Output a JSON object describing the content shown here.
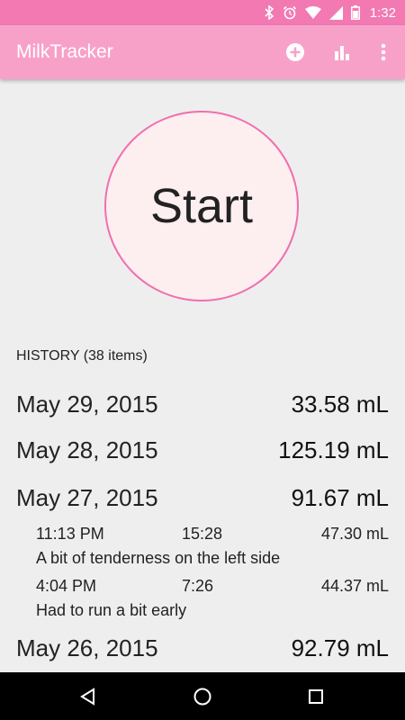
{
  "status_bar": {
    "time": "1:32"
  },
  "app_bar": {
    "title": "MilkTracker",
    "actions": [
      {
        "icon": "add-circle-icon"
      },
      {
        "icon": "bar-chart-icon"
      },
      {
        "icon": "more-vert-icon"
      }
    ]
  },
  "start_button": {
    "label": "Start"
  },
  "history": {
    "header": "HISTORY (38 items)",
    "days": [
      {
        "date": "May 29, 2015",
        "amount": "33.58 mL"
      },
      {
        "date": "May 28, 2015",
        "amount": "125.19 mL"
      },
      {
        "date": "May 27, 2015",
        "amount": "91.67 mL",
        "sessions": [
          {
            "time": "11:13 PM",
            "duration": "15:28",
            "volume": "47.30 mL",
            "note": "A bit of tenderness on the left side"
          },
          {
            "time": "4:04 PM",
            "duration": "7:26",
            "volume": "44.37 mL",
            "note": "Had to run a bit early"
          }
        ]
      },
      {
        "date": "May 26, 2015",
        "amount": "92.79 mL"
      }
    ]
  },
  "colors": {
    "status_bar": "#f279b2",
    "app_bar": "#f7a1c9",
    "start_border": "#f06fae",
    "start_fill": "#fdeef0"
  }
}
